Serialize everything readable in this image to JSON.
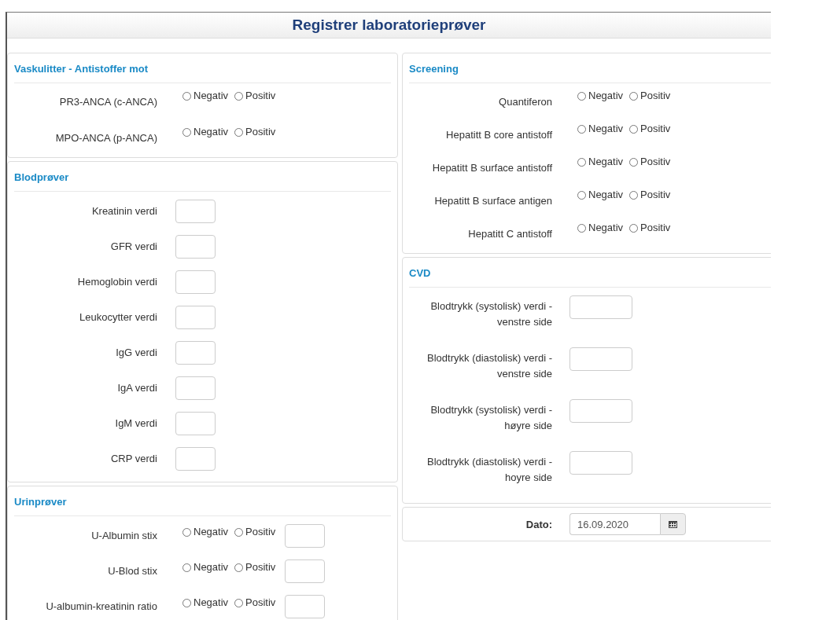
{
  "title": "Registrer laboratorieprøver",
  "left": [
    {
      "title": "Vaskulitter - Antistoffer mot",
      "rows": [
        {
          "kind": "radio",
          "label": "PR3-ANCA (c-ANCA)",
          "options": [
            {
              "label": "Negativ",
              "selected": false
            },
            {
              "label": "Positiv",
              "selected": false
            }
          ]
        },
        {
          "kind": "radio",
          "label": "MPO-ANCA (p-ANCA)",
          "options": [
            {
              "label": "Negativ",
              "selected": false
            },
            {
              "label": "Positiv",
              "selected": false
            }
          ]
        }
      ]
    },
    {
      "title": "Blodprøver",
      "rows": [
        {
          "kind": "input",
          "label": "Kreatinin verdi"
        },
        {
          "kind": "input",
          "label": "GFR verdi"
        },
        {
          "kind": "input",
          "label": "Hemoglobin verdi"
        },
        {
          "kind": "input",
          "label": "Leukocytter verdi"
        },
        {
          "kind": "input",
          "label": "IgG verdi"
        },
        {
          "kind": "input",
          "label": "IgA verdi"
        },
        {
          "kind": "input",
          "label": "IgM verdi"
        },
        {
          "kind": "input",
          "label": "CRP verdi"
        }
      ]
    },
    {
      "title": "Urinprøver",
      "rows": [
        {
          "kind": "radio_input",
          "label": "U-Albumin stix",
          "options": [
            {
              "label": "Negativ",
              "selected": false
            },
            {
              "label": "Positiv",
              "selected": false
            }
          ]
        },
        {
          "kind": "radio_input",
          "label": "U-Blod stix",
          "options": [
            {
              "label": "Negativ",
              "selected": false
            },
            {
              "label": "Positiv",
              "selected": false
            }
          ]
        },
        {
          "kind": "radio_input",
          "label": "U-albumin-kreatinin ratio",
          "options": [
            {
              "label": "Negativ",
              "selected": false
            },
            {
              "label": "Positiv",
              "selected": false
            }
          ]
        }
      ]
    }
  ],
  "right": [
    {
      "title": "Screening",
      "rows": [
        {
          "kind": "radio",
          "label": "Quantiferon",
          "options": [
            {
              "label": "Negativ",
              "selected": false
            },
            {
              "label": "Positiv",
              "selected": false
            }
          ]
        },
        {
          "kind": "radio",
          "label": "Hepatitt B core antistoff",
          "options": [
            {
              "label": "Negativ",
              "selected": false
            },
            {
              "label": "Positiv",
              "selected": false
            }
          ]
        },
        {
          "kind": "radio",
          "label": "Hepatitt B surface antistoff",
          "options": [
            {
              "label": "Negativ",
              "selected": false
            },
            {
              "label": "Positiv",
              "selected": false
            }
          ]
        },
        {
          "kind": "radio",
          "label": "Hepatitt B surface antigen",
          "options": [
            {
              "label": "Negativ",
              "selected": false
            },
            {
              "label": "Positiv",
              "selected": false
            }
          ]
        },
        {
          "kind": "radio",
          "label": "Hepatitt C antistoff",
          "options": [
            {
              "label": "Negativ",
              "selected": false
            },
            {
              "label": "Positiv",
              "selected": false
            }
          ]
        }
      ]
    },
    {
      "title": "CVD",
      "rows": [
        {
          "kind": "wide_input",
          "label": "Blodtrykk (systolisk) verdi - venstre side"
        },
        {
          "kind": "wide_input",
          "label": "Blodtrykk (diastolisk) verdi - venstre side"
        },
        {
          "kind": "wide_input",
          "label": "Blodtrykk (systolisk) verdi - høyre side"
        },
        {
          "kind": "wide_input",
          "label": "Blodtrykk (diastolisk) verdi - hoyre side"
        }
      ]
    }
  ],
  "date": {
    "label": "Dato:",
    "value": "16.09.2020"
  }
}
